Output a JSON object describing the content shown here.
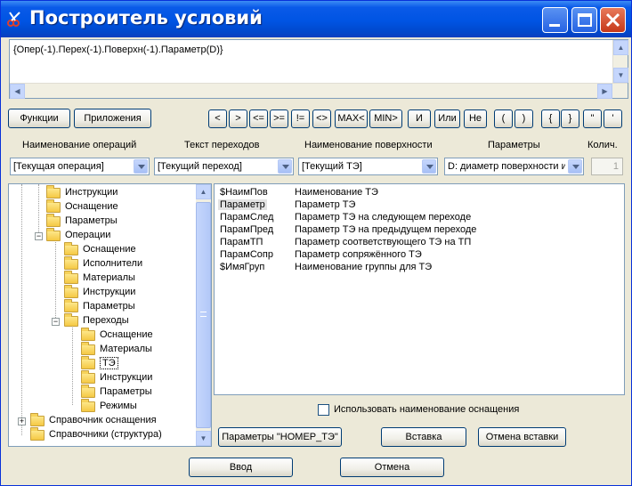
{
  "window": {
    "title": "Построитель условий",
    "controls": [
      "minimize",
      "maximize",
      "close"
    ]
  },
  "editor": {
    "expression": "{Опер(-1).Перех(-1).Поверхн(-1).Параметр(D)}"
  },
  "toolbar": {
    "functions_label": "Функции",
    "applications_label": "Приложения",
    "operators": [
      "<",
      ">",
      "<=",
      ">=",
      "!=",
      "<>",
      "MAX<",
      "MIN>",
      "И",
      "Или",
      "Не",
      "(",
      ")",
      "{",
      "}",
      "\"",
      "'"
    ]
  },
  "filters": {
    "operation_label": "Наименование операций",
    "operation_value": "[Текущая операция]",
    "transition_label": "Текст переходов",
    "transition_value": "[Текущий переход]",
    "surface_label": "Наименование поверхности",
    "surface_value": "[Текущий ТЭ]",
    "params_label": "Параметры",
    "params_value": "D: диаметр поверхности и",
    "count_label": "Колич.",
    "count_value": "1"
  },
  "tree": {
    "items": [
      {
        "label": "Инструкции",
        "level": 2
      },
      {
        "label": "Оснащение",
        "level": 2
      },
      {
        "label": "Параметры",
        "level": 2
      },
      {
        "label": "Операции",
        "level": 2,
        "expanded": true
      },
      {
        "label": "Оснащение",
        "level": 3
      },
      {
        "label": "Исполнители",
        "level": 3
      },
      {
        "label": "Материалы",
        "level": 3
      },
      {
        "label": "Инструкции",
        "level": 3
      },
      {
        "label": "Параметры",
        "level": 3
      },
      {
        "label": "Переходы",
        "level": 3,
        "expanded": true
      },
      {
        "label": "Оснащение",
        "level": 4
      },
      {
        "label": "Материалы",
        "level": 4
      },
      {
        "label": "ТЭ",
        "level": 4,
        "selected": true
      },
      {
        "label": "Инструкции",
        "level": 4
      },
      {
        "label": "Параметры",
        "level": 4
      },
      {
        "label": "Режимы",
        "level": 4
      },
      {
        "label": "Справочник оснащения",
        "level": 1,
        "collapsed": true
      },
      {
        "label": "Справочники (структура)",
        "level": 1
      }
    ]
  },
  "list": {
    "rows": [
      {
        "key": "$НаимПов",
        "desc": "Наименование ТЭ"
      },
      {
        "key": "Параметр",
        "desc": "Параметр ТЭ",
        "selected": true
      },
      {
        "key": "ПарамСлед",
        "desc": "Параметр ТЭ на следующем переходе"
      },
      {
        "key": "ПарамПред",
        "desc": "Параметр ТЭ на предыдущем переходе"
      },
      {
        "key": "ПарамТП",
        "desc": "Параметр соответствующего ТЭ на ТП"
      },
      {
        "key": "ПарамСопр",
        "desc": "Параметр сопряжённого ТЭ"
      },
      {
        "key": "$ИмяГруп",
        "desc": "Наименование группы для ТЭ"
      }
    ]
  },
  "options": {
    "use_equipment_name_label": "Использовать наименование оснащения"
  },
  "actions": {
    "params_number_te_label": "Параметры \"НОМЕР_ТЭ\"",
    "insert_label": "Вставка",
    "cancel_insert_label": "Отмена вставки",
    "enter_label": "Ввод",
    "cancel_label": "Отмена"
  },
  "colors": {
    "titlebar": "#0054e3",
    "window_bg": "#ece9d8",
    "border": "#7f9db9"
  }
}
